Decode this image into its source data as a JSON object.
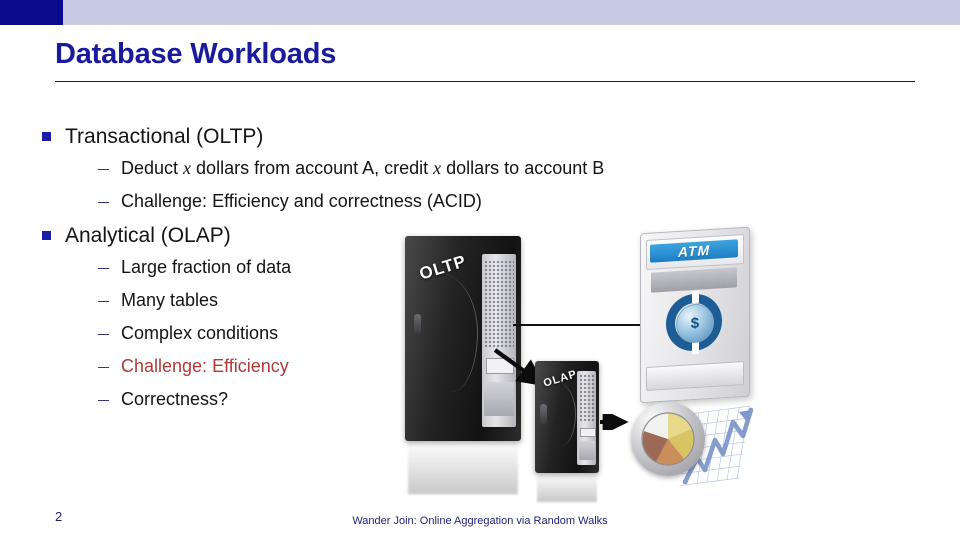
{
  "header": {
    "band_dark_color": "#0a0a8c",
    "band_light_color": "#c9cbe4"
  },
  "title": {
    "text": "Database Workloads",
    "color": "#1a1a9e"
  },
  "content": {
    "sections": [
      {
        "heading": "Transactional (OLTP)",
        "items": [
          {
            "prefix": "Deduct ",
            "var1": "x",
            "middle": " dollars from account A, credit ",
            "var2": "x",
            "suffix": " dollars to account B",
            "highlight": false
          },
          {
            "text": "Challenge: Efficiency and correctness (ACID)",
            "highlight": false
          }
        ]
      },
      {
        "heading": "Analytical (OLAP)",
        "items": [
          {
            "text": "Large fraction of data",
            "highlight": false
          },
          {
            "text": "Many tables",
            "highlight": false
          },
          {
            "text": "Complex conditions",
            "highlight": false
          },
          {
            "text": "Challenge: Efficiency",
            "highlight": true
          },
          {
            "text": "Correctness?",
            "highlight": false
          }
        ]
      }
    ],
    "highlight_color": "#b03a3a"
  },
  "diagram": {
    "oltp_label": "OLTP",
    "olap_label": "OLAP",
    "atm_label": "ATM",
    "currency_symbol": "$"
  },
  "footer": {
    "page_number": "2",
    "note": "Wander Join: Online Aggregation via Random Walks",
    "color": "#23237a"
  }
}
